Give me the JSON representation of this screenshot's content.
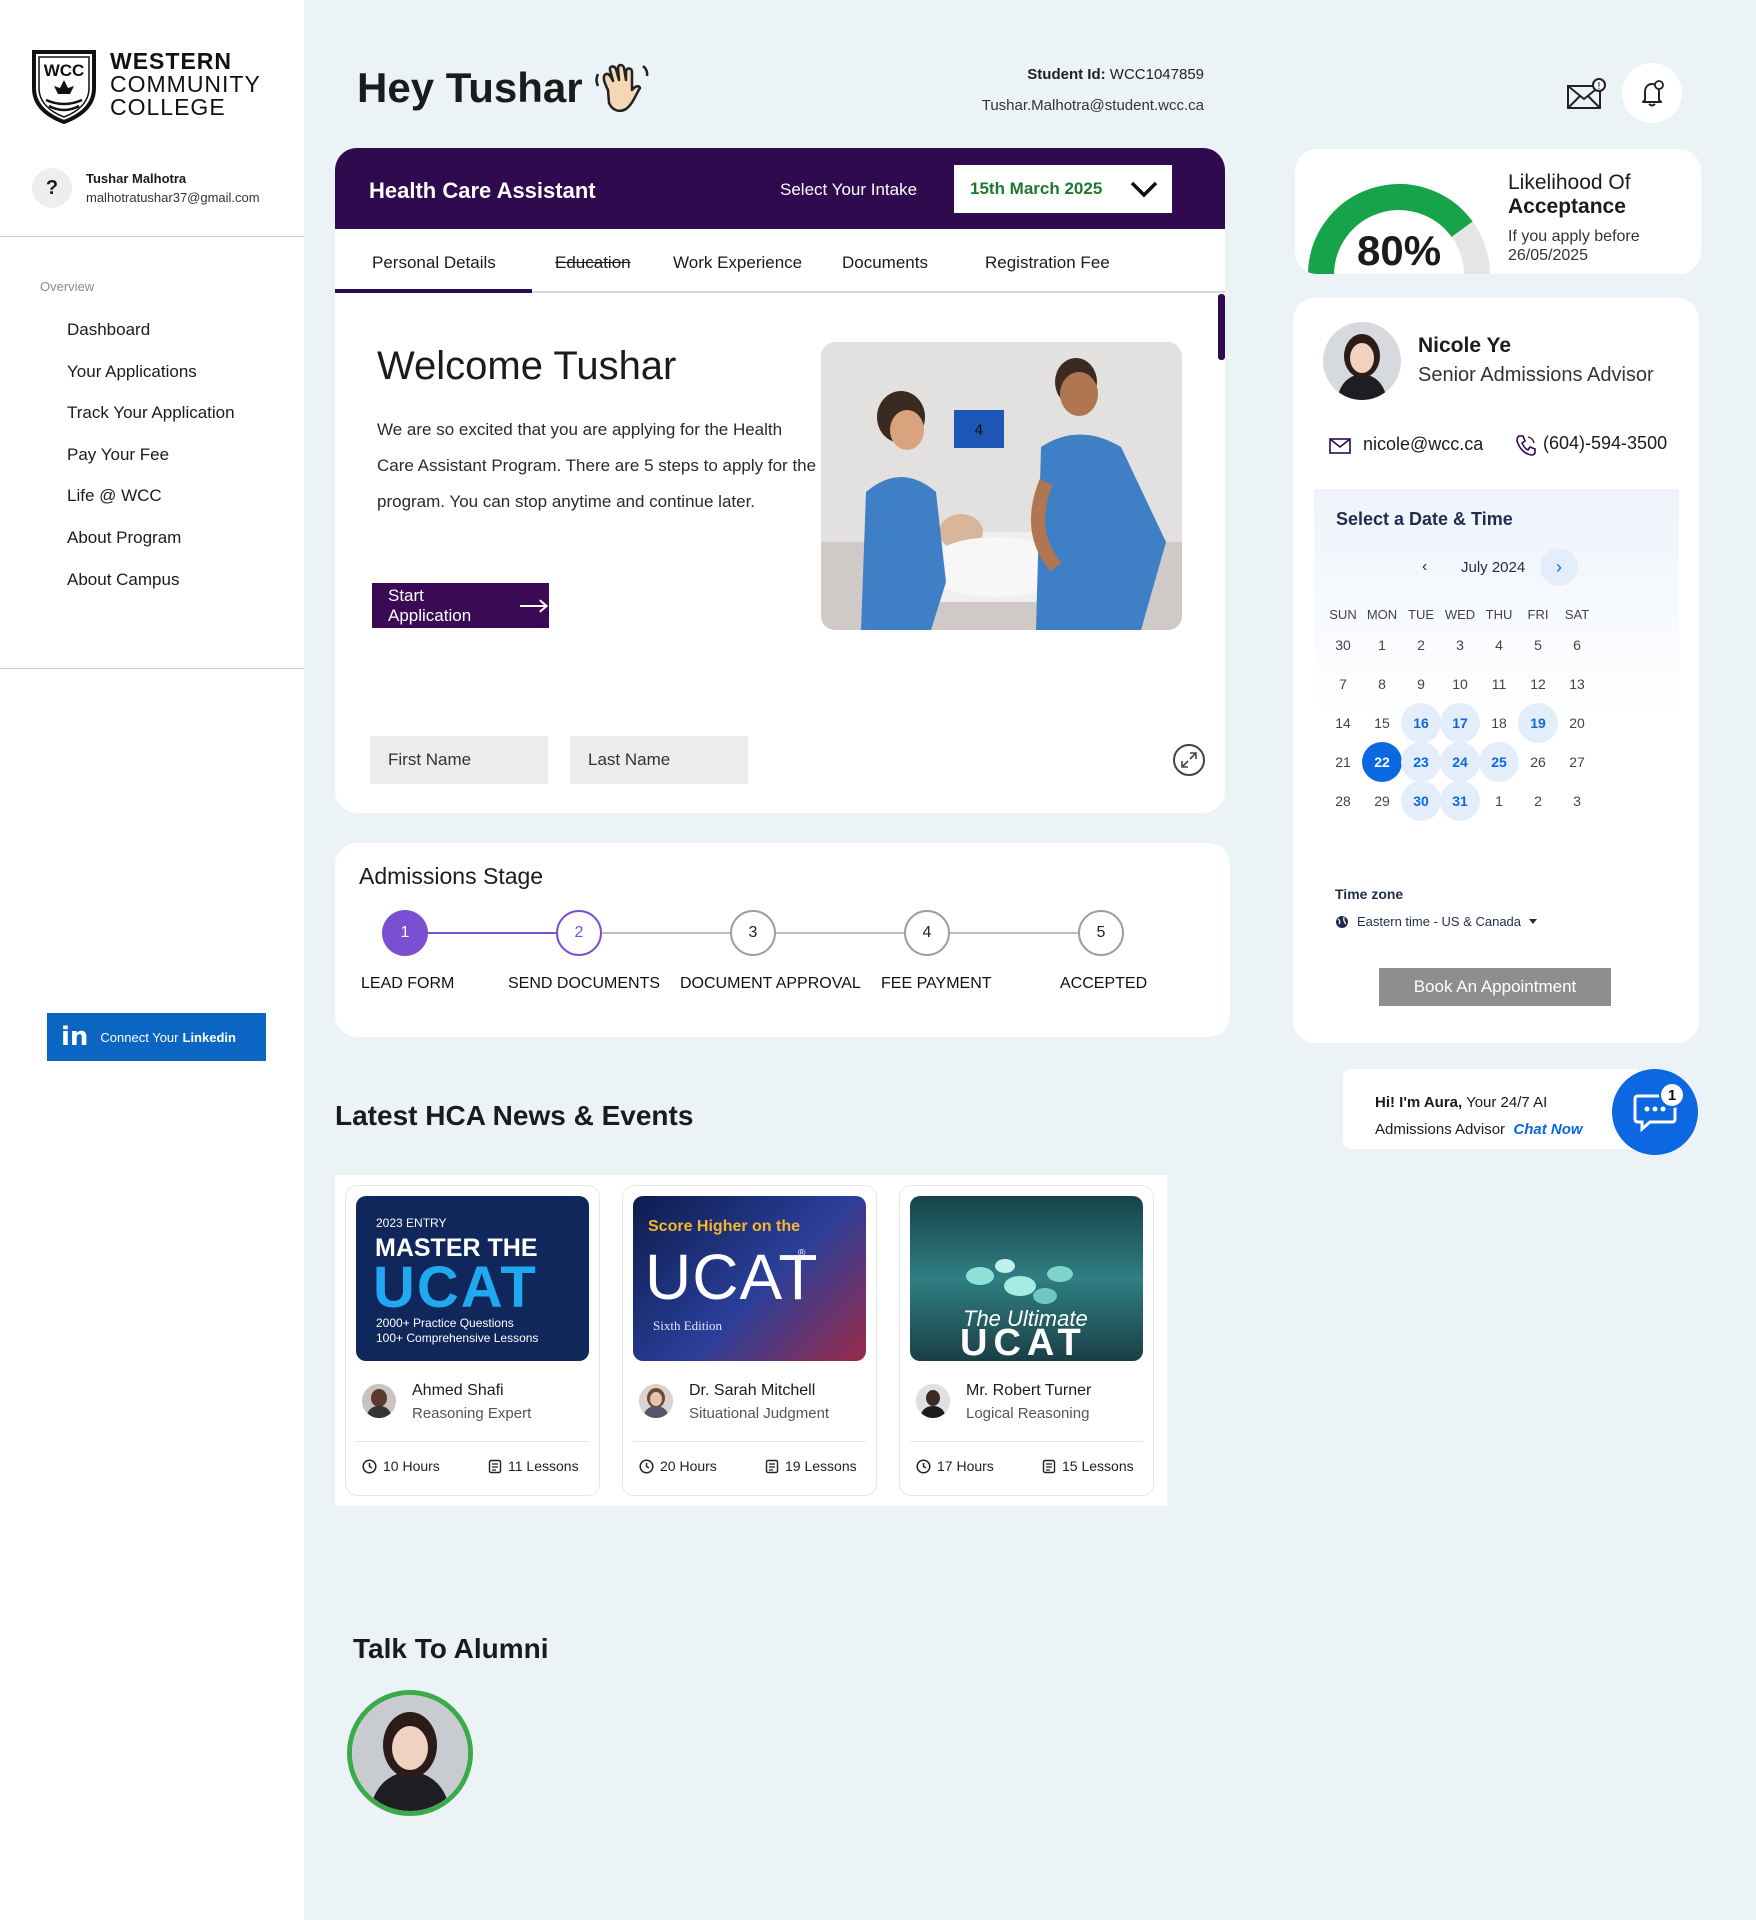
{
  "college": {
    "line1": "WESTERN",
    "line2": "COMMUNITY",
    "line3": "COLLEGE",
    "logo_text": "WCC"
  },
  "user": {
    "avatar_glyph": "?",
    "name": "Tushar Malhotra",
    "email": "malhotratushar37@gmail.com"
  },
  "sidebar": {
    "section_label": "Overview",
    "items": [
      {
        "label": "Dashboard"
      },
      {
        "label": "Your Applications"
      },
      {
        "label": "Track Your Application"
      },
      {
        "label": "Pay Your Fee"
      },
      {
        "label": "Life @ WCC"
      },
      {
        "label": "About Program"
      },
      {
        "label": "About Campus"
      }
    ],
    "linkedin": {
      "logo": "in",
      "text": "Connect Your",
      "bold": "Linkedin"
    }
  },
  "header": {
    "greeting": "Hey Tushar",
    "student_id_label": "Student Id:",
    "student_id": "WCC1047859",
    "student_email": "Tushar.Malhotra@student.wcc.ca"
  },
  "application": {
    "program": "Health Care Assistant",
    "intake_label": "Select Your Intake",
    "intake_value": "15th March 2025",
    "tabs": [
      {
        "label": "Personal Details"
      },
      {
        "label": "Education"
      },
      {
        "label": "Work Experience"
      },
      {
        "label": "Documents"
      },
      {
        "label": "Registration Fee"
      }
    ],
    "welcome_title": "Welcome Tushar",
    "welcome_text": "We are so excited that you are applying for the Health Care Assistant Program. There are 5 steps to apply for the program. You can stop anytime and continue later.",
    "start_button": "Start Application",
    "first_name_placeholder": "First Name",
    "last_name_placeholder": "Last Name",
    "photo_wall_number": "4"
  },
  "admissions": {
    "title": "Admissions Stage",
    "steps": [
      {
        "num": "1",
        "label": "LEAD FORM"
      },
      {
        "num": "2",
        "label": "SEND DOCUMENTS"
      },
      {
        "num": "3",
        "label": "DOCUMENT APPROVAL"
      },
      {
        "num": "4",
        "label": "FEE PAYMENT"
      },
      {
        "num": "5",
        "label": "ACCEPTED"
      }
    ],
    "current_step": 2,
    "accent_color": "#7b4fd1"
  },
  "likelihood": {
    "percent_text": "80%",
    "percent_value": 0.8,
    "title_line1": "Likelihood  Of",
    "title_line2": "Acceptance",
    "sub_line1": "If you apply before",
    "sub_line2": "26/05/2025",
    "gauge_color": "#16a34a"
  },
  "advisor": {
    "name": "Nicole Ye",
    "role": "Senior Admissions Advisor",
    "email": "nicole@wcc.ca",
    "phone": "(604)-594-3500"
  },
  "calendar": {
    "title": "Select a Date & Time",
    "month": "July 2024",
    "weekdays": [
      "SUN",
      "MON",
      "TUE",
      "WED",
      "THU",
      "FRI",
      "SAT"
    ],
    "weeks": [
      [
        "30",
        "1",
        "2",
        "3",
        "4",
        "5",
        "6"
      ],
      [
        "7",
        "8",
        "9",
        "10",
        "11",
        "12",
        "13"
      ],
      [
        "14",
        "15",
        "16",
        "17",
        "18",
        "19",
        "20"
      ],
      [
        "21",
        "22",
        "23",
        "24",
        "25",
        "26",
        "27"
      ],
      [
        "28",
        "29",
        "30",
        "31",
        "1",
        "2",
        "3"
      ]
    ],
    "available": [
      "2-2",
      "2-3",
      "2-5",
      "3-2",
      "3-3",
      "3-4",
      "4-2",
      "4-3"
    ],
    "selected": "3-1",
    "timezone_label": "Time zone",
    "timezone_value": "Eastern time - US & Canada",
    "book_button": "Book An Appointment"
  },
  "aura": {
    "greeting_bold": "Hi! I'm Aura,",
    "greeting_rest": " Your 24/7 AI",
    "line2": "Admissions Advisor",
    "cta": "Chat Now",
    "badge": "1"
  },
  "news": {
    "title": "Latest HCA News & Events",
    "cards": [
      {
        "img_l1": "2023 ENTRY",
        "img_l2": "MASTER THE",
        "img_l3": "UCAT",
        "img_l4": "2000+ Practice Questions",
        "img_l5": "100+ Comprehensive Lessons",
        "name": "Ahmed Shafi",
        "role": "Reasoning Expert",
        "hours": "10 Hours",
        "lessons": "11 Lessons"
      },
      {
        "img_l1": "Score Higher on the",
        "img_l2": "UCAT",
        "img_l3": "®",
        "img_l4": "Sixth Edition",
        "name": "Dr. Sarah Mitchell",
        "role": "Situational Judgment",
        "hours": "20 Hours",
        "lessons": "19 Lessons"
      },
      {
        "img_l1": "The Ultimate",
        "img_l2": "UCAT",
        "name": "Mr. Robert Turner",
        "role": "Logical Reasoning",
        "hours": "17 Hours",
        "lessons": "15 Lessons"
      }
    ]
  },
  "alumni": {
    "title": "Talk To Alumni"
  }
}
